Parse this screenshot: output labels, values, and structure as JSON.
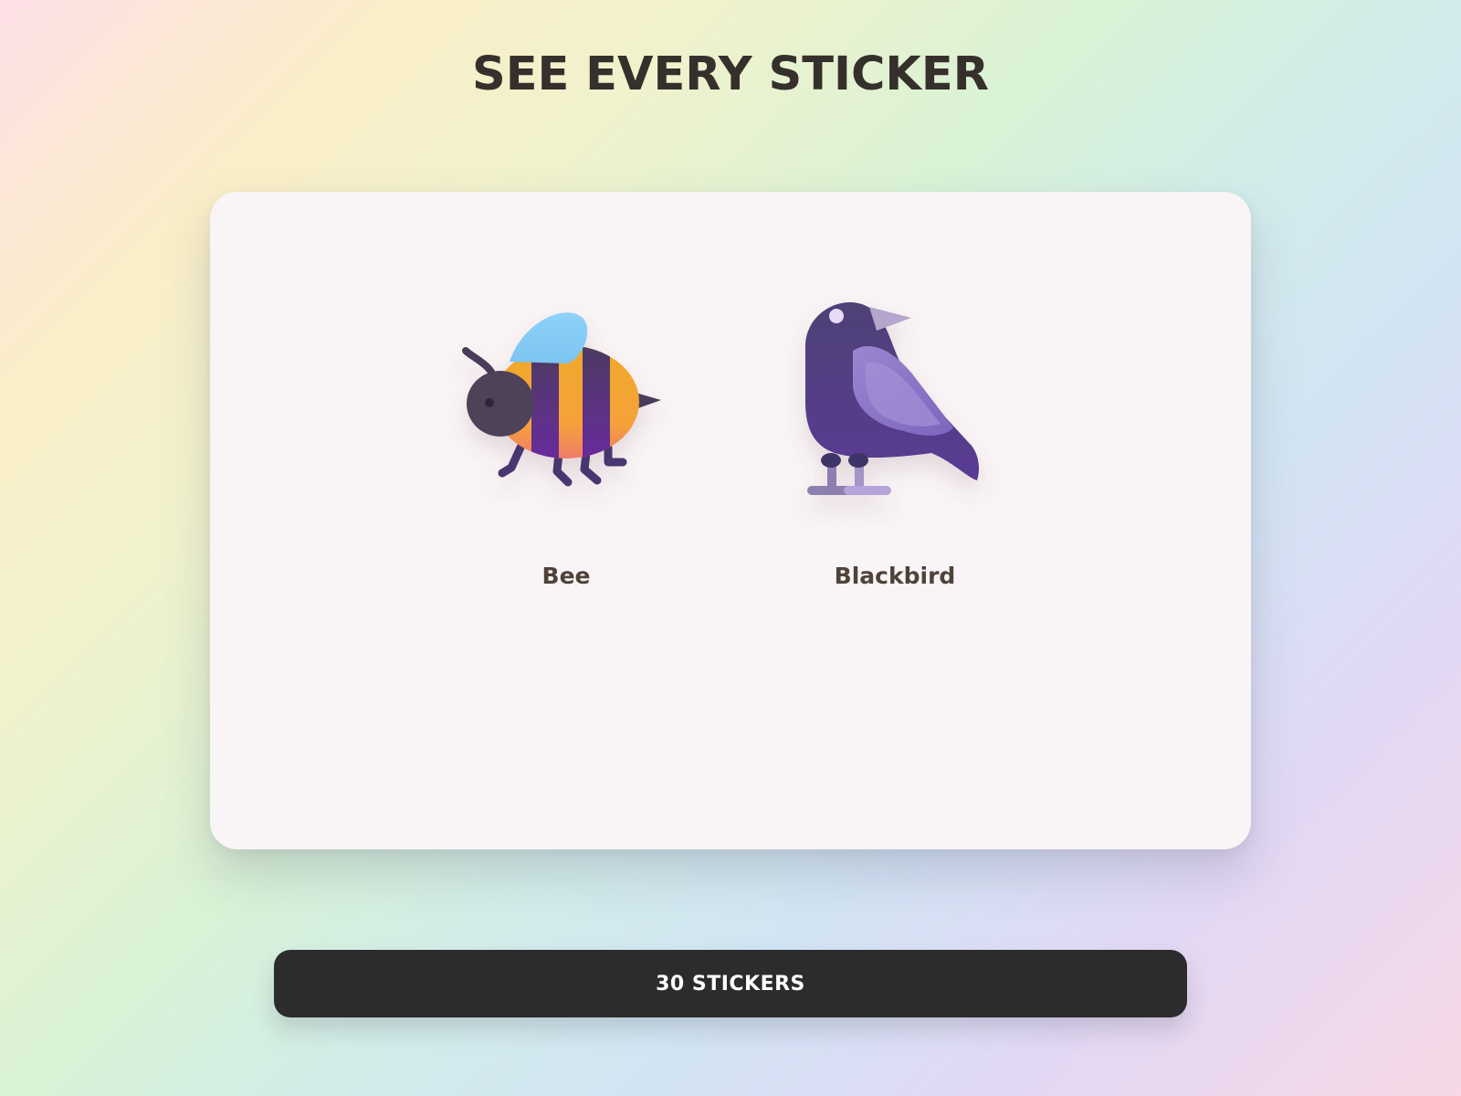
{
  "page": {
    "title": "SEE EVERY STICKER"
  },
  "stickers": [
    {
      "name": "Bee",
      "icon": "bee-icon"
    },
    {
      "name": "Blackbird",
      "icon": "blackbird-icon"
    }
  ],
  "footer": {
    "button_label": "30 STICKERS"
  },
  "colors": {
    "title": "#35302c",
    "card_background": "#f9f4f5",
    "sticker_label": "#4f4239",
    "button_background": "#2c2b2e",
    "button_text": "#ffffff"
  }
}
